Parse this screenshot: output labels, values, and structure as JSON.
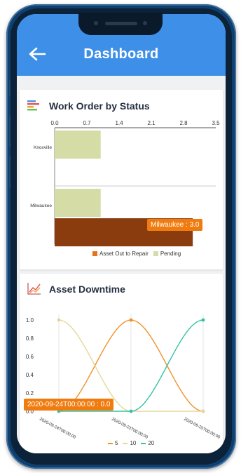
{
  "header": {
    "title": "Dashboard",
    "back_icon": "back-arrow-icon"
  },
  "colors": {
    "header": "#3e8fe8",
    "repair": "#8b3c0f",
    "pending": "#d6dca5",
    "tooltip": "#f07c10",
    "s5": "#f0922a",
    "s10": "#e5d79a",
    "s20": "#35c3a6"
  },
  "work_order_card": {
    "title": "Work Order by Status",
    "icon": "bar-chart-icon",
    "tooltip": "Milwaukee : 3.0",
    "legend": [
      "Asset Out to Repair",
      "Pending"
    ]
  },
  "downtime_card": {
    "title": "Asset Downtime",
    "icon": "line-chart-icon",
    "tooltip": "2020-09-24T00:00:00 : 0.0",
    "legend": [
      "5",
      "10",
      "20"
    ]
  },
  "chart_data": [
    {
      "type": "bar",
      "orientation": "horizontal",
      "title": "Work Order by Status",
      "categories": [
        "Knoxville",
        "Milwaukee"
      ],
      "x_ticks": [
        "0.0",
        "0.7",
        "1.4",
        "2.1",
        "2.8",
        "3.5"
      ],
      "xlim": [
        0,
        3.5
      ],
      "series": [
        {
          "name": "Asset Out to Repair",
          "values": [
            0,
            3.0
          ]
        },
        {
          "name": "Pending",
          "values": [
            1.0,
            1.0
          ]
        }
      ],
      "legend_position": "bottom"
    },
    {
      "type": "line",
      "title": "Asset Downtime",
      "x": [
        "2020-09-24T00:00:00",
        "2020-09-23T00:00:00",
        "2020-09-25T00:00:00"
      ],
      "y_ticks": [
        "0.0",
        "0.2",
        "0.4",
        "0.6",
        "0.8",
        "1.0"
      ],
      "ylim": [
        0,
        1
      ],
      "series": [
        {
          "name": "5",
          "values": [
            0.0,
            1.0,
            0.0
          ]
        },
        {
          "name": "10",
          "values": [
            1.0,
            0.0,
            0.0
          ]
        },
        {
          "name": "20",
          "values": [
            0.0,
            0.0,
            1.0
          ]
        }
      ],
      "legend_position": "bottom"
    }
  ]
}
